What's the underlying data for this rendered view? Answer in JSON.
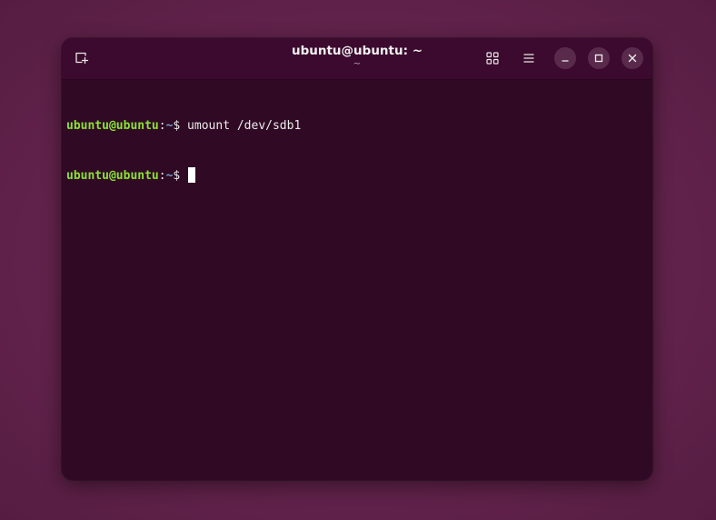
{
  "window": {
    "title": "ubuntu@ubuntu: ~",
    "subtitle": "~"
  },
  "titlebar_icons": {
    "new_tab": "new-tab-icon",
    "view_toggle": "grid-icon",
    "menu": "hamburger-menu-icon",
    "minimize": "minimize-icon",
    "maximize": "maximize-icon",
    "close": "close-icon"
  },
  "terminal": {
    "lines": [
      {
        "user": "ubuntu@ubuntu",
        "sep": ":",
        "path": "~",
        "symbol": "$",
        "command": " umount /dev/sdb1"
      },
      {
        "user": "ubuntu@ubuntu",
        "sep": ":",
        "path": "~",
        "symbol": "$",
        "command": " "
      }
    ]
  },
  "colors": {
    "terminal_bg": "#300a24",
    "titlebar_bg": "#3c0a2e",
    "prompt_user": "#8ae234",
    "prompt_path": "#729fcf",
    "text": "#ececec"
  }
}
